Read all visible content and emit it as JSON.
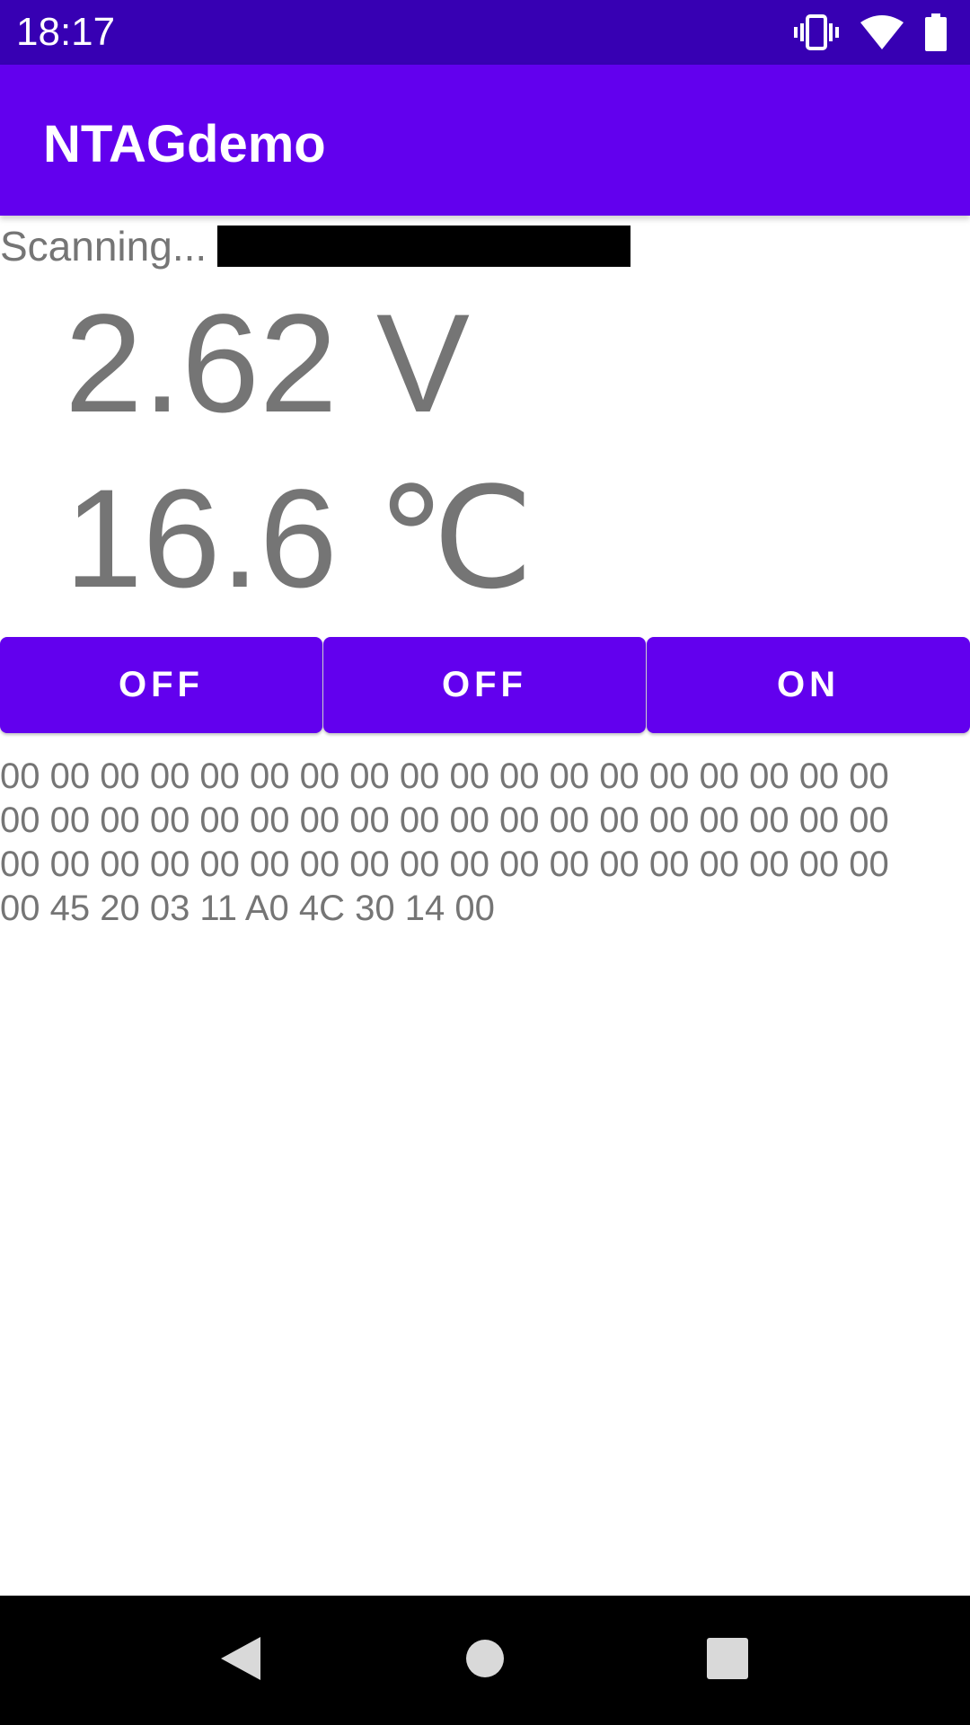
{
  "status_bar": {
    "time": "18:17",
    "icons": [
      "vibrate-icon",
      "wifi-icon",
      "battery-icon"
    ]
  },
  "app_bar": {
    "title": "NTAGdemo"
  },
  "scan": {
    "label": "Scanning..."
  },
  "readings": {
    "voltage": "2.62 V",
    "temperature": "16.6 ℃"
  },
  "buttons": [
    {
      "label": "OFF"
    },
    {
      "label": "OFF"
    },
    {
      "label": "ON"
    }
  ],
  "hex_dump": [
    "00 00 00 00 00 00 00 00 00 00 00 00 00 00 00 00 00 00",
    "00 00 00 00 00 00 00 00 00 00 00 00 00 00 00 00 00 00",
    "00 00 00 00 00 00 00 00 00 00 00 00 00 00 00 00 00 00",
    "00 45 20 03 11 A0 4C 30 14 00"
  ],
  "nav_bar": {
    "icons": [
      "back-icon",
      "home-icon",
      "recents-icon"
    ]
  },
  "colors": {
    "status_bar": "#3700b3",
    "primary": "#6200ee",
    "text_secondary": "#757575",
    "redaction": "#000000"
  }
}
